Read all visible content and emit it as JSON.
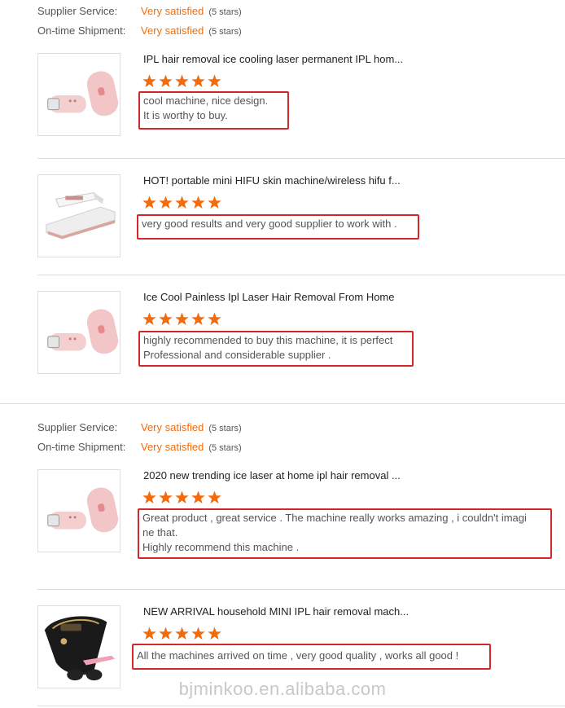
{
  "colors": {
    "accent": "#f26c0d",
    "highlight_border": "#d3282a",
    "star": "#f26c0d"
  },
  "supplier_ratings": [
    {
      "service_label": "Supplier Service:",
      "service_value": "Very satisfied",
      "service_count": "(5 stars)",
      "shipment_label": "On-time Shipment:",
      "shipment_value": "Very satisfied",
      "shipment_count": "(5 stars)"
    },
    {
      "service_label": "Supplier Service:",
      "service_value": "Very satisfied",
      "service_count": "(5 stars)",
      "shipment_label": "On-time Shipment:",
      "shipment_value": "Very satisfied",
      "shipment_count": "(5 stars)"
    }
  ],
  "reviews": [
    {
      "title": "IPL hair removal ice cooling laser permanent IPL hom...",
      "stars": 5,
      "comment": "cool machine, nice design.\nIt is worthy to buy.",
      "image": "pink-ipl-device"
    },
    {
      "title": "HOT! portable mini HIFU skin machine/wireless hifu f...",
      "stars": 5,
      "comment": "very good results and very good supplier to work with .",
      "image": "white-hifu-device"
    },
    {
      "title": "Ice Cool Painless Ipl Laser Hair Removal From Home",
      "stars": 5,
      "comment": "highly recommended to buy this machine, it is perfect\nProfessional and considerable supplier .",
      "image": "pink-ipl-device"
    },
    {
      "title": "2020 new trending ice laser at home ipl hair removal ...",
      "stars": 5,
      "comment": "Great product , great service . The machine really works amazing , i couldn't imagi\nne that.\nHighly recommend this machine .",
      "image": "pink-ipl-device"
    },
    {
      "title": "NEW ARRIVAL household MINI IPL hair removal mach...",
      "stars": 5,
      "comment": "All the machines arrived on time , very good quality , works all good !",
      "image": "black-ipl-device"
    }
  ],
  "watermark": "bjminkoo.en.alibaba.com"
}
